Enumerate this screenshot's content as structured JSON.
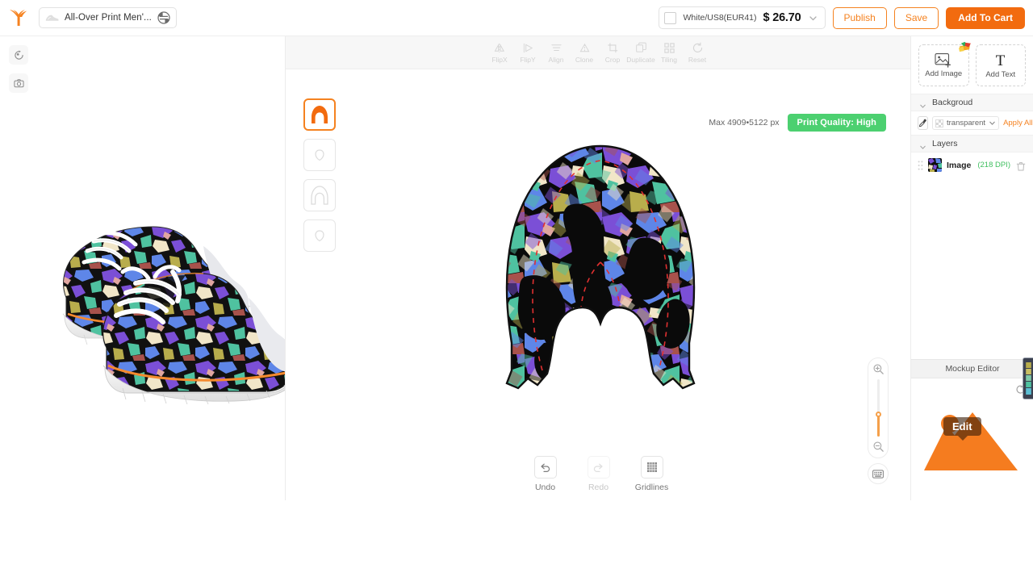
{
  "app": {
    "brand_color": "#f58220",
    "logo_name": "phoenix-logo"
  },
  "topbar": {
    "product_title": "All-Over Print Men'...",
    "variant_label": "White/US8(EUR41)",
    "price": "$ 26.70",
    "publish_label": "Publish",
    "save_label": "Save",
    "add_to_cart_label": "Add To Cart"
  },
  "left_rail": {
    "items": [
      {
        "name": "rotate-view-icon"
      },
      {
        "name": "camera-icon"
      }
    ]
  },
  "editor": {
    "toolbar": [
      {
        "label": "FlipX",
        "icon": "flip-x-icon",
        "disabled": true
      },
      {
        "label": "FlipY",
        "icon": "flip-y-icon",
        "disabled": true
      },
      {
        "label": "Align",
        "icon": "align-icon",
        "disabled": true
      },
      {
        "label": "Clone",
        "icon": "clone-icon",
        "disabled": true
      },
      {
        "label": "Crop",
        "icon": "crop-icon",
        "disabled": true
      },
      {
        "label": "Duplicate",
        "icon": "duplicate-icon",
        "disabled": true
      },
      {
        "label": "Tiling",
        "icon": "tiling-icon",
        "disabled": true
      },
      {
        "label": "Reset",
        "icon": "reset-icon",
        "disabled": true
      }
    ],
    "max_resolution": "Max 4909•5122 px",
    "print_quality": "Print Quality: High",
    "print_quality_color": "#4cd070",
    "parts": [
      {
        "name": "part-upper",
        "active": true
      },
      {
        "name": "part-tongue",
        "active": false
      },
      {
        "name": "part-lining",
        "active": false
      },
      {
        "name": "part-insole",
        "active": false
      }
    ],
    "bottom_tools": [
      {
        "label": "Undo",
        "icon": "undo-icon",
        "disabled": false
      },
      {
        "label": "Redo",
        "icon": "redo-icon",
        "disabled": true
      },
      {
        "label": "Gridlines",
        "icon": "gridlines-icon",
        "disabled": false
      }
    ],
    "zoom": {
      "in_icon": "zoom-in-icon",
      "out_icon": "zoom-out-icon",
      "value_pct": 38
    },
    "keyboard_shortcut_icon": "keyboard-icon"
  },
  "right_panel": {
    "add_image_label": "Add Image",
    "add_text_label": "Add Text",
    "background_section": "Backgroud",
    "background_value": "transparent",
    "apply_all_label": "Apply All",
    "layers_section": "Layers",
    "layers": [
      {
        "name": "Image",
        "dpi": "(218 DPI)",
        "dpi_color": "#3fbf5f"
      }
    ],
    "mockup_editor_title": "Mockup Editor",
    "mockup_edit_label": "Edit"
  }
}
